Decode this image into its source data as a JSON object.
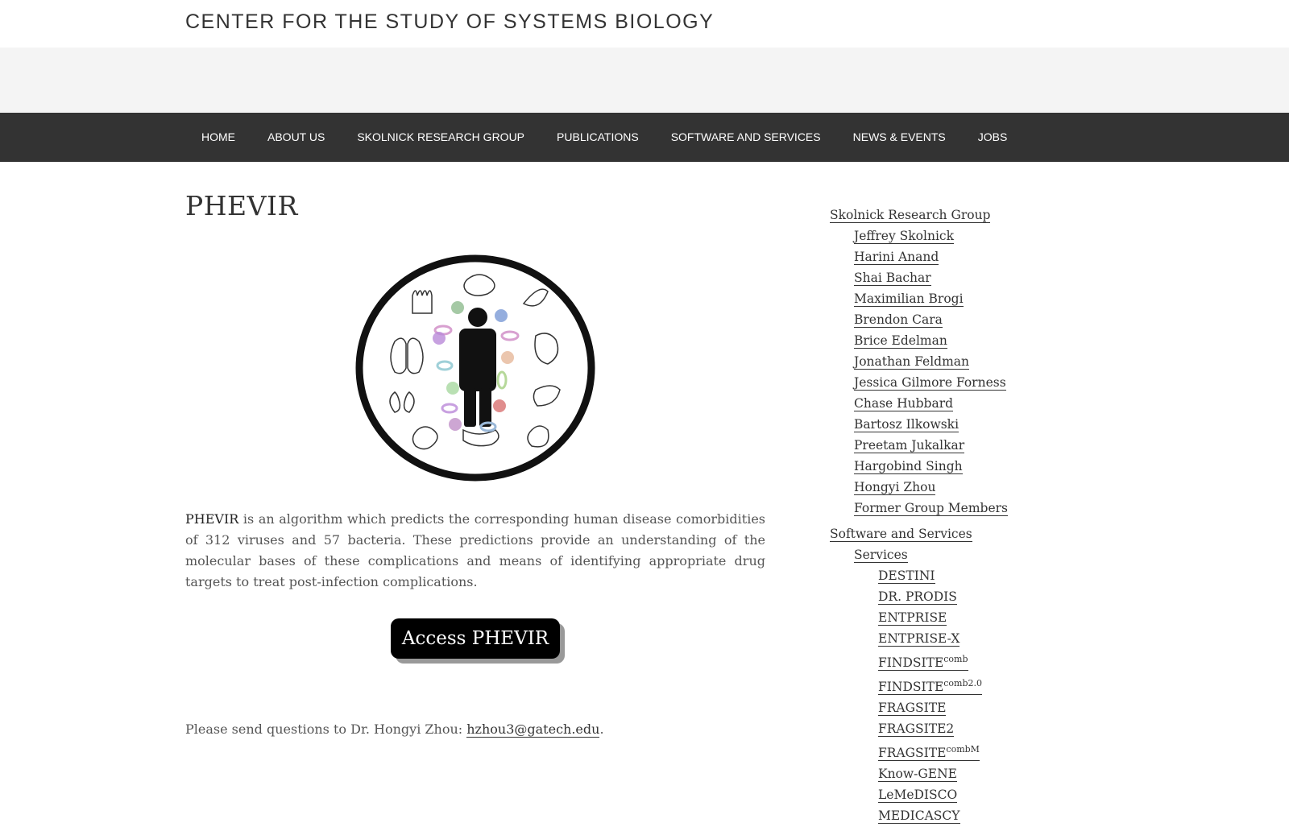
{
  "site": {
    "title": "Center for the Study of Systems Biology"
  },
  "nav": {
    "items": [
      "Home",
      "About Us",
      "Skolnick Research Group",
      "Publications",
      "Software and Services",
      "News & Events",
      "Jobs"
    ]
  },
  "page": {
    "title": "PHEVIR",
    "intro_term": "PHEVIR",
    "intro_text": " is an algorithm which predicts the corresponding human disease comorbidities of 312 viruses and 57 bacteria. These predictions provide an understanding of the molecular bases of these complications and means of identifying appropriate drug targets to treat post-infection complications.",
    "button_label": "Access PHEVIR",
    "contact_text": "Please send questions to Dr. Hongyi Zhou: ",
    "contact_email": "hzhou3@gatech.edu",
    "contact_end": "."
  },
  "sidebar": {
    "group": {
      "label": "Skolnick Research Group",
      "members": [
        "Jeffrey Skolnick",
        "Harini Anand",
        "Shai Bachar",
        "Maximilian Brogi",
        "Brendon Cara",
        "Brice Edelman",
        "Jonathan Feldman",
        "Jessica Gilmore Forness",
        "Chase Hubbard",
        "Bartosz Ilkowski",
        "Preetam Jukalkar",
        "Hargobind Singh",
        "Hongyi Zhou",
        "Former Group Members"
      ]
    },
    "software": {
      "label": "Software and Services",
      "services_label": "Services",
      "services": [
        {
          "name": "DESTINI",
          "sup": ""
        },
        {
          "name": "DR. PRODIS",
          "sup": ""
        },
        {
          "name": "ENTPRISE",
          "sup": ""
        },
        {
          "name": "ENTPRISE-X",
          "sup": ""
        },
        {
          "name": "FINDSITE",
          "sup": "comb"
        },
        {
          "name": "FINDSITE",
          "sup": "comb2.0"
        },
        {
          "name": "FRAGSITE",
          "sup": ""
        },
        {
          "name": "FRAGSITE2",
          "sup": ""
        },
        {
          "name": "FRAGSITE",
          "sup": "combM"
        },
        {
          "name": "Know-GENE",
          "sup": ""
        },
        {
          "name": "LeMeDISCO",
          "sup": ""
        },
        {
          "name": "MEDICASCY",
          "sup": ""
        }
      ]
    }
  }
}
